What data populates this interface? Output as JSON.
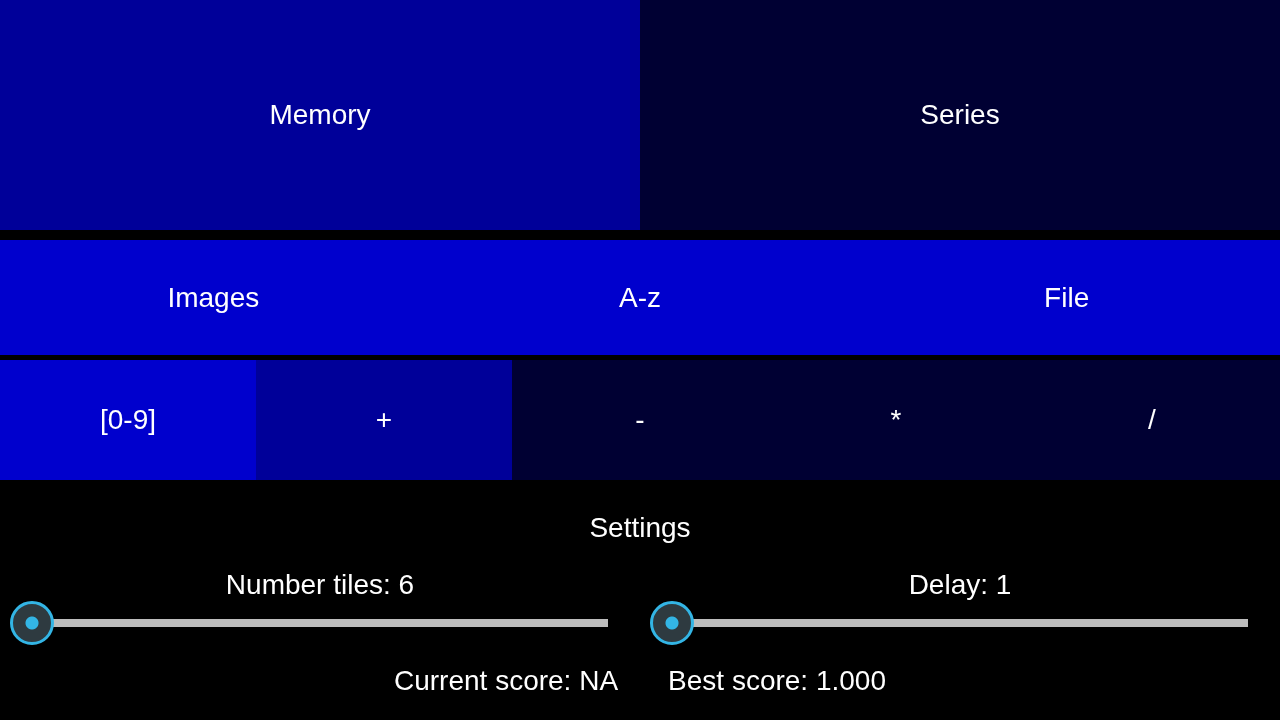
{
  "modes": [
    {
      "label": "Memory",
      "selected": true
    },
    {
      "label": "Series",
      "selected": false
    }
  ],
  "sources": [
    {
      "label": "Images"
    },
    {
      "label": "A-z"
    },
    {
      "label": "File"
    }
  ],
  "operations": [
    {
      "label": "[0-9]",
      "kind": "digits",
      "selected": true
    },
    {
      "label": "+",
      "kind": "operator",
      "selected": true
    },
    {
      "label": "-",
      "kind": "operator",
      "selected": false
    },
    {
      "label": "*",
      "kind": "operator",
      "selected": false
    },
    {
      "label": "/",
      "kind": "operator",
      "selected": false
    }
  ],
  "settings": {
    "title": "Settings",
    "sliders": [
      {
        "label": "Number tiles: 6",
        "level": 0
      },
      {
        "label": "Delay: 1",
        "level": 0
      }
    ],
    "current_score": "Current score: NA",
    "best_score": "Best score: 1.000"
  }
}
